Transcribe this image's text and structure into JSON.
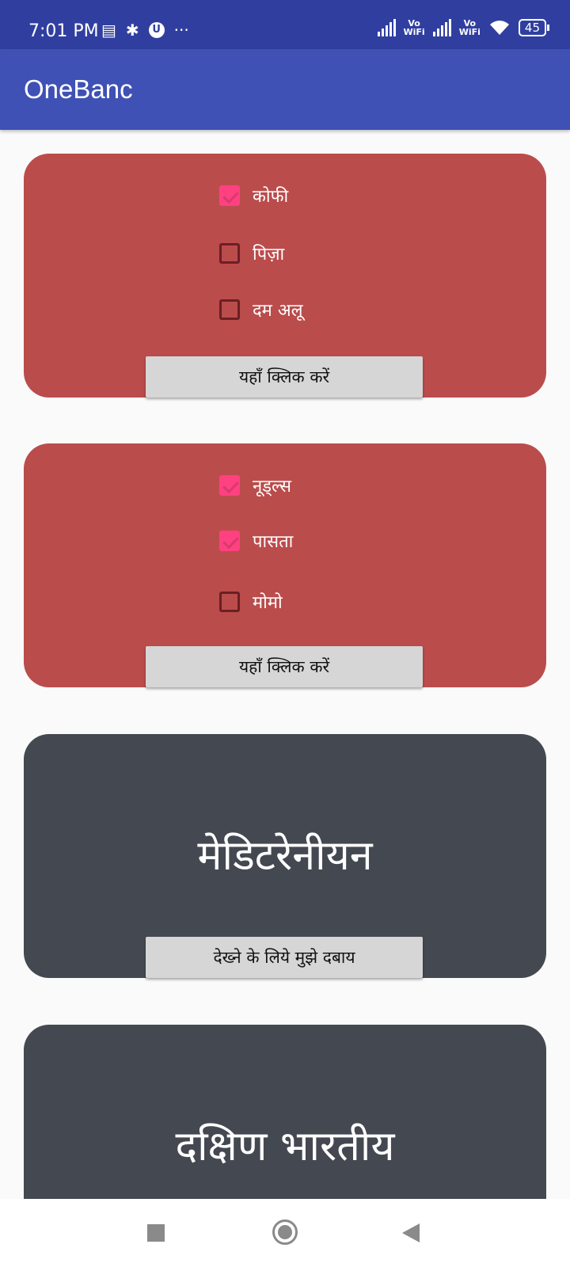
{
  "status_bar": {
    "time": "7:01 PM",
    "icons": [
      "notes-icon",
      "usb-debug-icon",
      "u-badge-icon",
      "more-dots-icon"
    ],
    "vowifi_label_top": "Vo",
    "vowifi_label_bottom": "WiFi",
    "battery": "45"
  },
  "app_bar": {
    "title": "OneBanc"
  },
  "cards": [
    {
      "items": [
        {
          "label": "कोफी",
          "checked": true
        },
        {
          "label": "पिज़ा",
          "checked": false
        },
        {
          "label": "दम अलू",
          "checked": false
        }
      ],
      "button_label": "यहाँ क्लिक करें"
    },
    {
      "items": [
        {
          "label": "नूड्ल्स",
          "checked": true
        },
        {
          "label": "पासता",
          "checked": true
        },
        {
          "label": "मोमो",
          "checked": false
        }
      ],
      "button_label": "यहाँ क्लिक करें"
    },
    {
      "title": "मेडिटरेनीयन",
      "button_label": "देख्ने के लिये मुझे दबाय"
    },
    {
      "title": "दक्षिण भारतीय"
    }
  ],
  "colors": {
    "status_bar": "#303f9f",
    "app_bar": "#3f51b5",
    "card_red": "#bb4c4c",
    "card_dark": "#444851",
    "checkbox_checked": "#ff4081"
  },
  "nav_bar": {
    "icons": [
      "recents-square-icon",
      "home-circle-icon",
      "back-triangle-icon"
    ]
  }
}
